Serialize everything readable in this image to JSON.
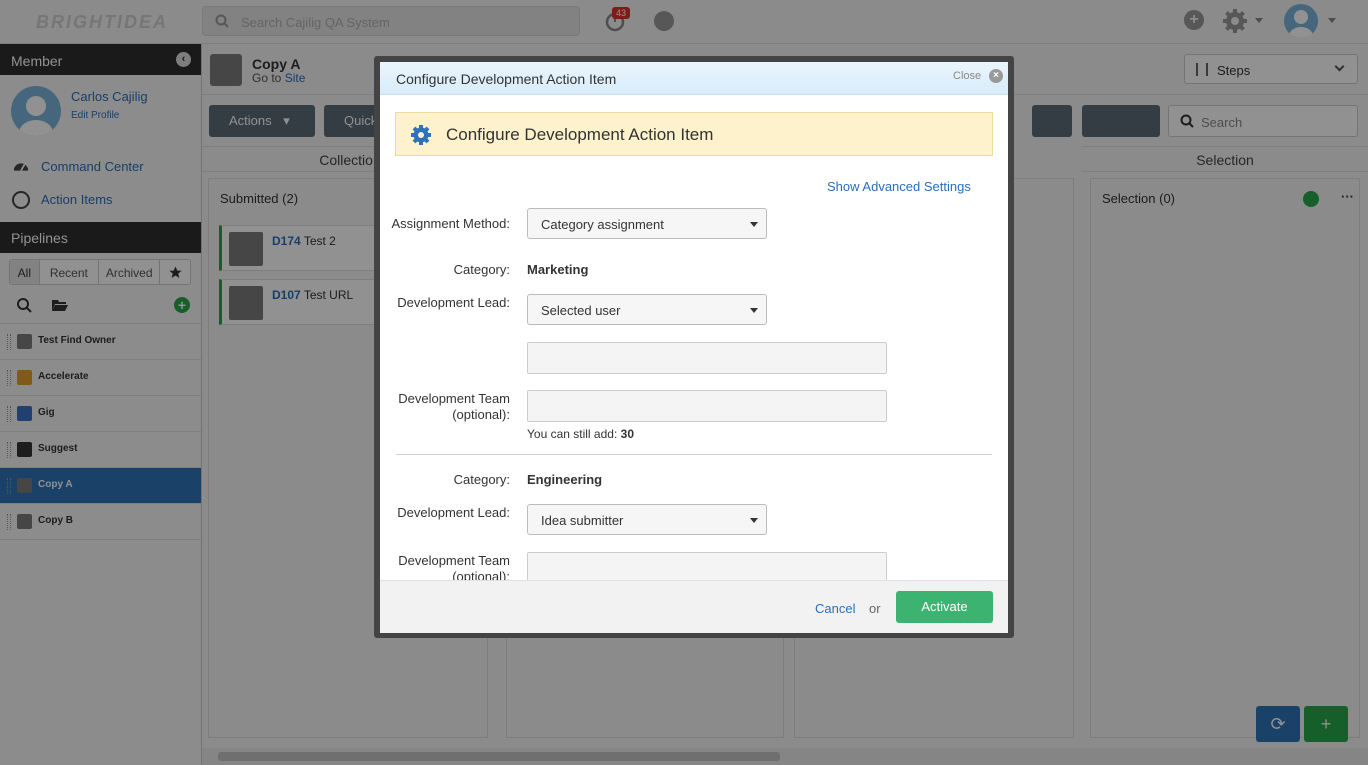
{
  "app": {
    "logo": "BRIGHTIDEA",
    "search_placeholder": "Search Cajilig QA System",
    "notification_count": "43"
  },
  "sidebar": {
    "member_header": "Member",
    "user_name": "Carlos Cajilig",
    "edit_profile": "Edit Profile",
    "nav": [
      {
        "label": "Command Center",
        "icon": "dashboard-icon"
      },
      {
        "label": "Action Items",
        "icon": "clock-icon"
      }
    ],
    "pipelines_header": "Pipelines",
    "tabs": [
      "All",
      "Recent",
      "Archived"
    ],
    "pipelines": [
      {
        "label": "Test Find Owner",
        "color": "#7b7b7b"
      },
      {
        "label": "Accelerate",
        "color": "#e0a12a"
      },
      {
        "label": "Gig",
        "color": "#3a6fc4"
      },
      {
        "label": "Suggest",
        "color": "#333333"
      },
      {
        "label": "Copy A",
        "color": "#7b7b7b"
      },
      {
        "label": "Copy B",
        "color": "#7b7b7b"
      }
    ]
  },
  "page": {
    "title": "Copy A",
    "goto_text": "Go to",
    "goto_link": "Site",
    "steps_label": "Steps",
    "actions_label": "Actions",
    "quick_label": "Quick",
    "search_placeholder": "Search"
  },
  "columns": {
    "col1_header": "Collection",
    "col1_sub": "Submitted",
    "col1_count": "(2)",
    "cards": [
      {
        "id": "D174",
        "title": "Test 2"
      },
      {
        "id": "D107",
        "title": "Test URL"
      }
    ],
    "col4_header": "Selection",
    "col4_sub": "Selection",
    "col4_count": "(0)"
  },
  "modal": {
    "title": "Configure Development Action Item",
    "close_label": "Close",
    "banner_title": "Configure Development Action Item",
    "advanced_link": "Show Advanced Settings",
    "assignment_method_label": "Assignment Method:",
    "assignment_method_value": "Category assignment",
    "categories": [
      {
        "category_label": "Category:",
        "category_name": "Marketing",
        "lead_label": "Development Lead:",
        "lead_value": "Selected user",
        "team_label": "Development Team (optional):",
        "hint_prefix": "You can still add:",
        "hint_count": "30"
      },
      {
        "category_label": "Category:",
        "category_name": "Engineering",
        "lead_label": "Development Lead:",
        "lead_value": "Idea submitter",
        "team_label": "Development Team (optional):"
      }
    ],
    "cancel_label": "Cancel",
    "or_label": "or",
    "activate_label": "Activate"
  },
  "colors": {
    "accent_blue": "#2a6ebb",
    "active_green": "#3cb371",
    "banner_yellow": "#fdf2cc",
    "sidebar_dark": "#2f2f2f"
  }
}
